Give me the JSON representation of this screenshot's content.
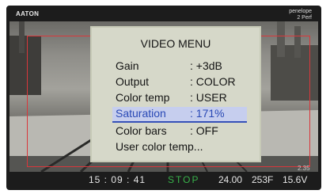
{
  "overlay": {
    "brand": "AATON",
    "device_name": "penelope",
    "device_sub": "2 Perf"
  },
  "menu": {
    "title": "VIDEO MENU",
    "items": [
      {
        "label": "Gain",
        "value": ": +3dB",
        "selected": false
      },
      {
        "label": "Output",
        "value": ": COLOR",
        "selected": false
      },
      {
        "label": "Color temp",
        "value": ": USER",
        "selected": false
      },
      {
        "label": "Saturation",
        "value": ": 171%",
        "selected": true
      },
      {
        "label": "Color bars",
        "value": ": OFF",
        "selected": false
      },
      {
        "label": "User color temp...",
        "value": "",
        "selected": false
      }
    ]
  },
  "status": {
    "timecode": "15 : 09 : 41",
    "state": "STOP",
    "fps": "24.00",
    "frames": "253F",
    "voltage": "15.6V",
    "aux": "2.35"
  },
  "colors": {
    "frame_line": "#d9373b",
    "menu_bg": "#d6d8c9",
    "selection_text": "#2949b5",
    "stop_text": "#38b14a"
  }
}
